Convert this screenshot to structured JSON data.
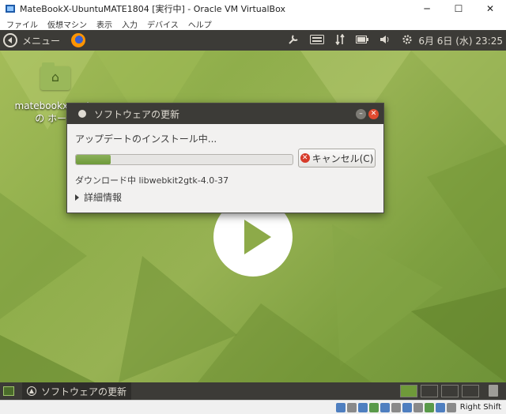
{
  "vbox": {
    "title": "MateBookX-UbuntuMATE1804 [実行中] - Oracle VM VirtualBox",
    "menu": [
      "ファイル",
      "仮想マシン",
      "表示",
      "入力",
      "デバイス",
      "ヘルプ"
    ],
    "controls": {
      "minimize": "─",
      "maximize": "☐",
      "close": "✕"
    },
    "host_key": "Right Shift"
  },
  "top_panel": {
    "menu_label": "メニュー",
    "clock": "6月 6日 (水) 23:25"
  },
  "desktop": {
    "home_label": "matebookx-mate の ホーム"
  },
  "dialog": {
    "title": "ソフトウェアの更新",
    "status": "アップデートのインストール中...",
    "progress": 0.16,
    "cancel_label": "キャンセル(C)",
    "download": "ダウンロード中 libwebkit2gtk-4.0-37",
    "details_label": "詳細情報"
  },
  "bottom_panel": {
    "task_label": "ソフトウェアの更新"
  },
  "colors": {
    "panel": "#3c3b37",
    "accent_green": "#87a556",
    "close_red": "#e04a2f"
  }
}
